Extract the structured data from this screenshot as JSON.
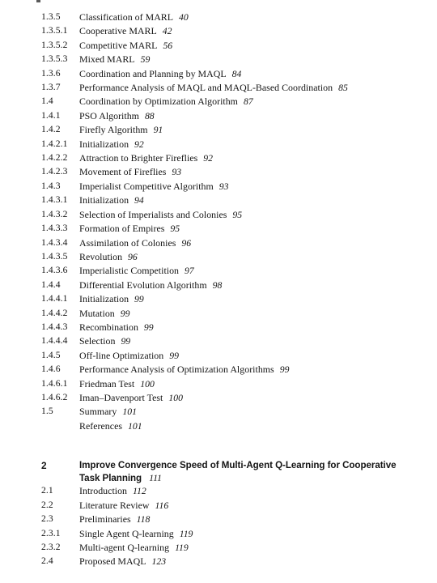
{
  "page": {
    "artifact_note": "clipped-running-head-glyph",
    "background_color": "#ffffff",
    "text_color": "#141414"
  },
  "toc": {
    "entries": [
      {
        "number": "1.3.5",
        "title": "Classification of MARL",
        "page": "40"
      },
      {
        "number": "1.3.5.1",
        "title": "Cooperative MARL",
        "page": "42"
      },
      {
        "number": "1.3.5.2",
        "title": "Competitive MARL",
        "page": "56"
      },
      {
        "number": "1.3.5.3",
        "title": "Mixed MARL",
        "page": "59"
      },
      {
        "number": "1.3.6",
        "title": "Coordination and Planning by MAQL",
        "page": "84"
      },
      {
        "number": "1.3.7",
        "title": "Performance Analysis of MAQL and MAQL-Based Coordination",
        "page": "85"
      },
      {
        "number": "1.4",
        "title": "Coordination by Optimization Algorithm",
        "page": "87"
      },
      {
        "number": "1.4.1",
        "title": "PSO Algorithm",
        "page": "88"
      },
      {
        "number": "1.4.2",
        "title": "Firefly Algorithm",
        "page": "91"
      },
      {
        "number": "1.4.2.1",
        "title": "Initialization",
        "page": "92"
      },
      {
        "number": "1.4.2.2",
        "title": "Attraction to Brighter Fireflies",
        "page": "92"
      },
      {
        "number": "1.4.2.3",
        "title": "Movement of Fireflies",
        "page": "93"
      },
      {
        "number": "1.4.3",
        "title": "Imperialist Competitive Algorithm",
        "page": "93"
      },
      {
        "number": "1.4.3.1",
        "title": "Initialization",
        "page": "94"
      },
      {
        "number": "1.4.3.2",
        "title": "Selection of Imperialists and Colonies",
        "page": "95"
      },
      {
        "number": "1.4.3.3",
        "title": "Formation of Empires",
        "page": "95"
      },
      {
        "number": "1.4.3.4",
        "title": "Assimilation of Colonies",
        "page": "96"
      },
      {
        "number": "1.4.3.5",
        "title": "Revolution",
        "page": "96"
      },
      {
        "number": "1.4.3.6",
        "title": "Imperialistic Competition",
        "page": "97"
      },
      {
        "number": "1.4.4",
        "title": "Differential Evolution Algorithm",
        "page": "98"
      },
      {
        "number": "1.4.4.1",
        "title": "Initialization",
        "page": "99"
      },
      {
        "number": "1.4.4.2",
        "title": "Mutation",
        "page": "99"
      },
      {
        "number": "1.4.4.3",
        "title": "Recombination",
        "page": "99"
      },
      {
        "number": "1.4.4.4",
        "title": "Selection",
        "page": "99"
      },
      {
        "number": "1.4.5",
        "title": "Off-line Optimization",
        "page": "99"
      },
      {
        "number": "1.4.6",
        "title": "Performance Analysis of Optimization Algorithms",
        "page": "99"
      },
      {
        "number": "1.4.6.1",
        "title": "Friedman Test",
        "page": "100"
      },
      {
        "number": "1.4.6.2",
        "title": "Iman–Davenport Test",
        "page": "100"
      },
      {
        "number": "1.5",
        "title": "Summary",
        "page": "101"
      },
      {
        "number": "",
        "title": "References",
        "page": "101"
      },
      {
        "number": "2",
        "title": "Improve Convergence Speed of Multi-Agent Q-Learning for Cooperative Task Planning",
        "page": "111",
        "style": "chapter",
        "gap_before": true
      },
      {
        "number": "2.1",
        "title": "Introduction",
        "page": "112"
      },
      {
        "number": "2.2",
        "title": "Literature Review",
        "page": "116"
      },
      {
        "number": "2.3",
        "title": "Preliminaries",
        "page": "118"
      },
      {
        "number": "2.3.1",
        "title": "Single Agent Q-learning",
        "page": "119"
      },
      {
        "number": "2.3.2",
        "title": "Multi-agent Q-learning",
        "page": "119"
      },
      {
        "number": "2.4",
        "title": "Proposed MAQL",
        "page": "123"
      }
    ]
  }
}
